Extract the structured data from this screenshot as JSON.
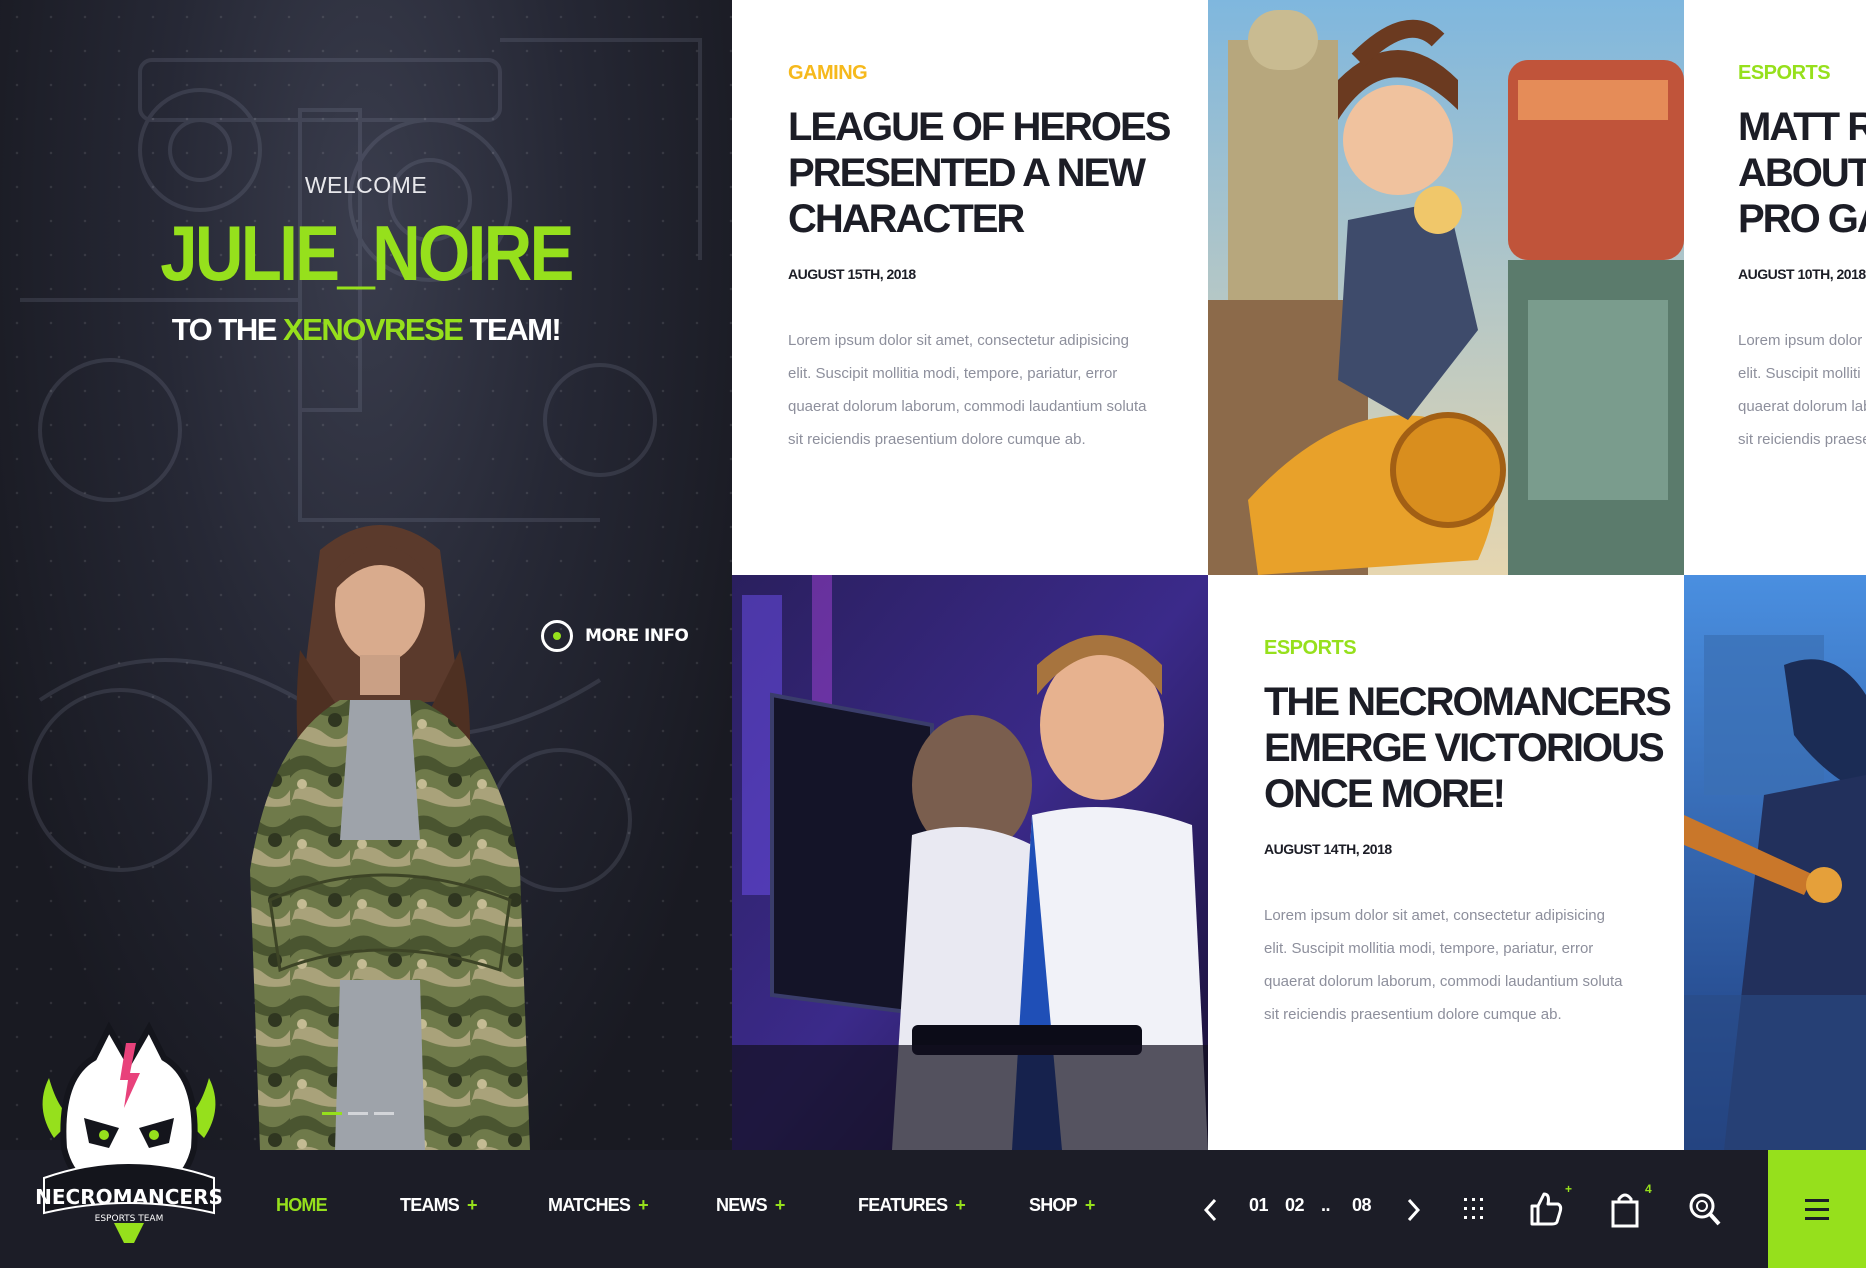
{
  "hero": {
    "welcome": "WELCOME",
    "name": "JULIE_NOIRE",
    "team_prefix": "TO THE ",
    "team_name": "XENOVRESE",
    "team_suffix": " TEAM!",
    "more_info": "MORE INFO",
    "slider": {
      "count": 3,
      "active": 1
    }
  },
  "logo": {
    "name": "NECROMANCERS",
    "subtitle": "ESPORTS TEAM"
  },
  "articles": [
    {
      "category": "GAMING",
      "title_lines": [
        "LEAGUE OF HEROES",
        "PRESENTED A NEW",
        "CHARACTER"
      ],
      "date": "AUGUST 15TH, 2018",
      "excerpt_lines": [
        "Lorem ipsum dolor sit amet, consectetur adipisicing",
        "elit. Suscipit mollitia modi, tempore, pariatur, error",
        "quaerat dolorum laborum, commodi laudantium soluta",
        "sit reiciendis praesentium dolore cumque ab."
      ]
    },
    {
      "category": "ESPORTS",
      "title_lines": [
        "MATT RO",
        "ABOUT B",
        "PRO GAN"
      ],
      "date": "AUGUST 10TH, 2018",
      "excerpt_lines": [
        "Lorem ipsum dolor",
        "elit. Suscipit molliti",
        "quaerat dolorum lab",
        "sit reiciendis praese"
      ]
    },
    {
      "category": "ESPORTS",
      "title_lines": [
        "THE NECROMANCERS",
        "EMERGE VICTORIOUS",
        "ONCE MORE!"
      ],
      "date": "AUGUST 14TH, 2018",
      "excerpt_lines": [
        "Lorem ipsum dolor sit amet, consectetur adipisicing",
        "elit. Suscipit mollitia modi, tempore, pariatur, error",
        "quaerat dolorum laborum, commodi laudantium soluta",
        "sit reiciendis praesentium dolore cumque ab."
      ]
    }
  ],
  "nav": {
    "items": [
      {
        "label": "HOME",
        "has_submenu": false,
        "active": true
      },
      {
        "label": "TEAMS",
        "has_submenu": true,
        "active": false
      },
      {
        "label": "MATCHES",
        "has_submenu": true,
        "active": false
      },
      {
        "label": "NEWS",
        "has_submenu": true,
        "active": false
      },
      {
        "label": "FEATURES",
        "has_submenu": true,
        "active": false
      },
      {
        "label": "SHOP",
        "has_submenu": true,
        "active": false
      }
    ],
    "plus": "+",
    "pagination": {
      "pages": [
        "01",
        "02"
      ],
      "ellipsis": "..",
      "last": "08"
    },
    "icons": [
      "grid-icon",
      "thumbs-up-icon",
      "shopping-bag-icon",
      "search-icon",
      "menu-icon"
    ],
    "likes_badge": "+",
    "cart_badge": "4"
  },
  "colors": {
    "accent": "#96e01c",
    "gaming": "#f6b91c",
    "dark": "#1c1d27",
    "text": "#1c1d26",
    "muted": "#8d8f9c"
  }
}
